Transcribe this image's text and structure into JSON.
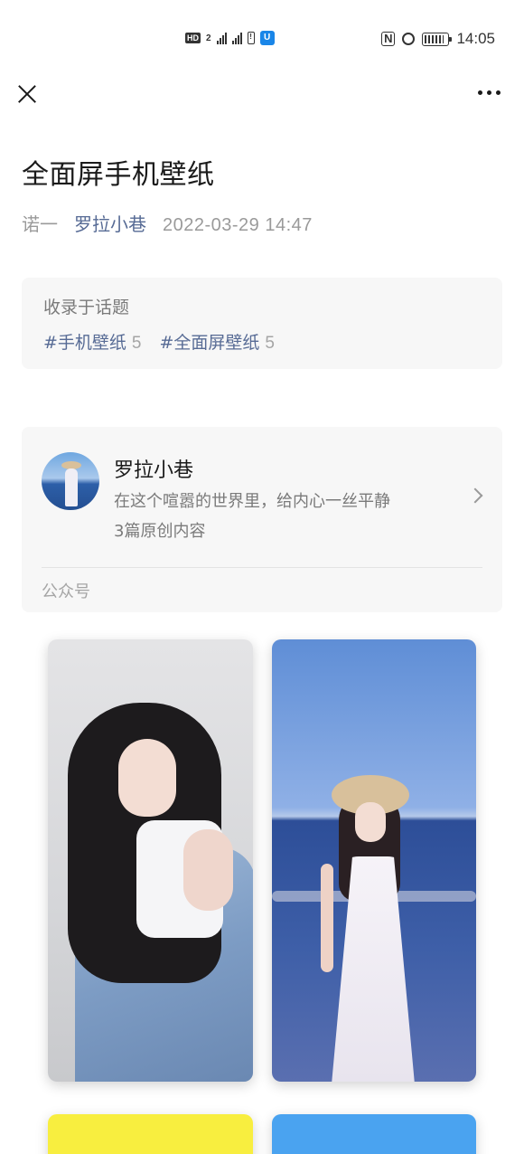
{
  "status_bar": {
    "hd_label": "HD",
    "sim_label": "2",
    "network1": "4G",
    "network2": "4G",
    "warn": "!",
    "app_badge": "U",
    "nfc": "N",
    "time": "14:05"
  },
  "nav": {
    "close_icon": "close-icon",
    "more_icon": "more-icon"
  },
  "article": {
    "title": "全面屏手机壁纸",
    "author": "诺一",
    "account": "罗拉小巷",
    "date": "2022-03-29 14:47"
  },
  "topics": {
    "label": "收录于话题",
    "tags": [
      {
        "name": "#手机壁纸",
        "count": "5"
      },
      {
        "name": "#全面屏壁纸",
        "count": "5"
      }
    ]
  },
  "profile": {
    "name": "罗拉小巷",
    "description": "在这个喧嚣的世界里，给内心一丝平静",
    "count": "3篇原创内容",
    "type": "公众号"
  },
  "colors": {
    "link": "#576b95",
    "card_bg": "#f7f7f7",
    "wall_yellow": "#f8ee3f",
    "wall_blue": "#4aa3f0"
  }
}
